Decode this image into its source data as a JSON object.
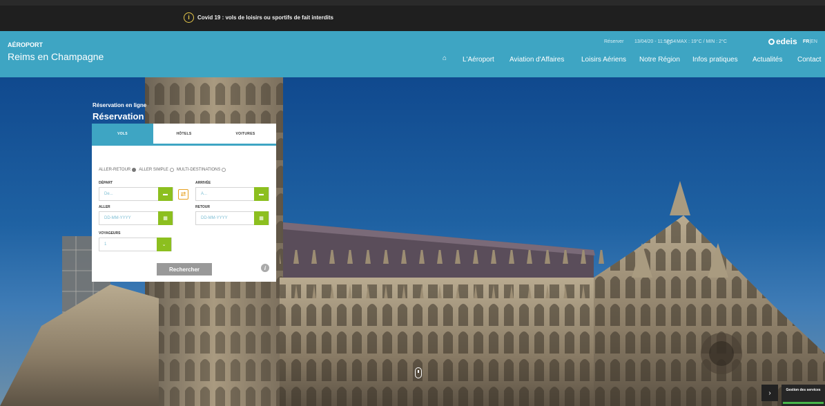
{
  "covid": {
    "text": "Covid 19 : vols de loisirs ou sportifs de fait interdits",
    "icon": "info-icon"
  },
  "brand": {
    "top": "AÉROPORT",
    "sub": "Reims en Champagne"
  },
  "utility": {
    "reserver": "Réserver",
    "datetime": "13/04/20 - 11:50:54",
    "weather": "MAX : 19°C / MIN : 2°C",
    "logo": "edeis",
    "lang_fr": "FR",
    "lang_sep": "|",
    "lang_en": "EN"
  },
  "nav": {
    "items": [
      "L'Aéroport",
      "Aviation d'Affaires",
      "Loisirs Aériens",
      "Notre Région",
      "Infos pratiques",
      "Actualités",
      "Contact"
    ]
  },
  "booking": {
    "label_small": "Réservation en ligne",
    "label_big": "Réservation",
    "tabs": [
      "VOLS",
      "HÔTELS",
      "VOITURES"
    ],
    "trip_types": [
      "ALLER-RETOUR",
      "ALLER SIMPLE",
      "MULTI-DESTINATIONS"
    ],
    "departure_label": "DÉPART",
    "departure_placeholder": "De...",
    "arrival_label": "ARRIVÉE",
    "arrival_placeholder": "A...",
    "outbound_label": "ALLER",
    "outbound_placeholder": "DD-MM-YYYY",
    "return_label": "RETOUR",
    "return_placeholder": "DD-MM-YYYY",
    "travelers_label": "VOYAGEURS",
    "travelers_value": "1",
    "search_button": "Rechercher"
  },
  "services": {
    "label": "Gestion des services"
  },
  "colors": {
    "header": "#3ea5c3",
    "green": "#8cbf1f",
    "swap": "#e6a020"
  }
}
